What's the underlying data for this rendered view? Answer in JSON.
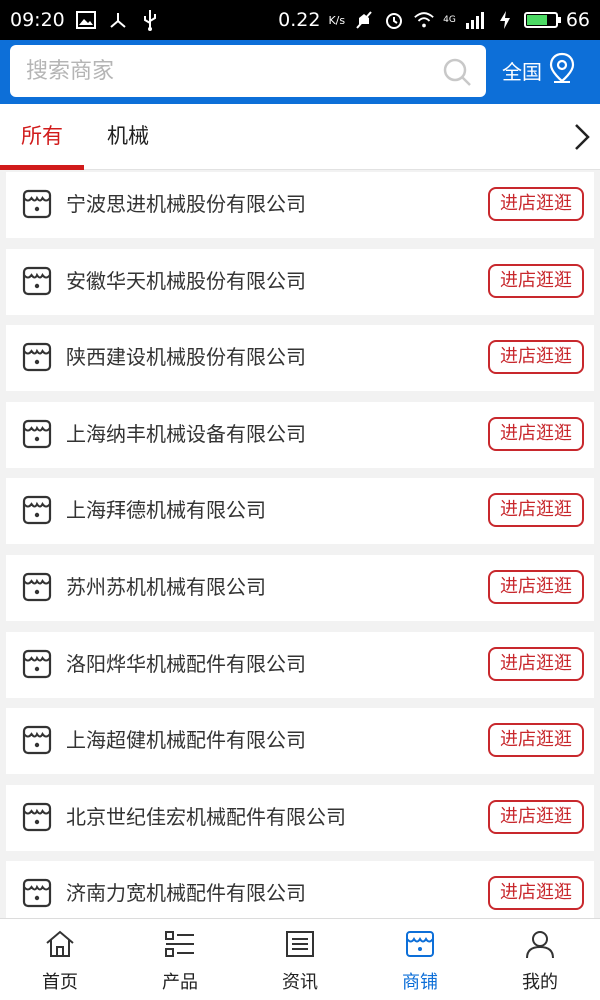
{
  "status_bar": {
    "time": "09:20",
    "net_speed": "0.22",
    "net_unit": "K/s",
    "signal": "4G",
    "battery": "66",
    "battery_level": 0.66
  },
  "header": {
    "search_placeholder": "搜索商家",
    "region_label": "全国"
  },
  "tabs": [
    {
      "label": "所有",
      "active": true
    },
    {
      "label": "机械",
      "active": false
    }
  ],
  "visit_label": "进店逛逛",
  "shops": [
    {
      "name": "宁波思进机械股份有限公司"
    },
    {
      "name": "安徽华天机械股份有限公司"
    },
    {
      "name": "陕西建设机械股份有限公司"
    },
    {
      "name": "上海纳丰机械设备有限公司"
    },
    {
      "name": "上海拜德机械有限公司"
    },
    {
      "name": "苏州苏机机械有限公司"
    },
    {
      "name": "洛阳烨华机械配件有限公司"
    },
    {
      "name": "上海超健机械配件有限公司"
    },
    {
      "name": "北京世纪佳宏机械配件有限公司"
    },
    {
      "name": "济南力宽机械配件有限公司"
    }
  ],
  "bottom_nav": [
    {
      "label": "首页",
      "icon": "home-icon",
      "active": false
    },
    {
      "label": "产品",
      "icon": "product-list-icon",
      "active": false
    },
    {
      "label": "资讯",
      "icon": "news-icon",
      "active": false
    },
    {
      "label": "商铺",
      "icon": "shop-icon",
      "active": true
    },
    {
      "label": "我的",
      "icon": "user-icon",
      "active": false
    }
  ],
  "colors": {
    "brand_blue": "#0d6fd8",
    "accent_red": "#d11b1b",
    "button_red": "#c8282d"
  }
}
